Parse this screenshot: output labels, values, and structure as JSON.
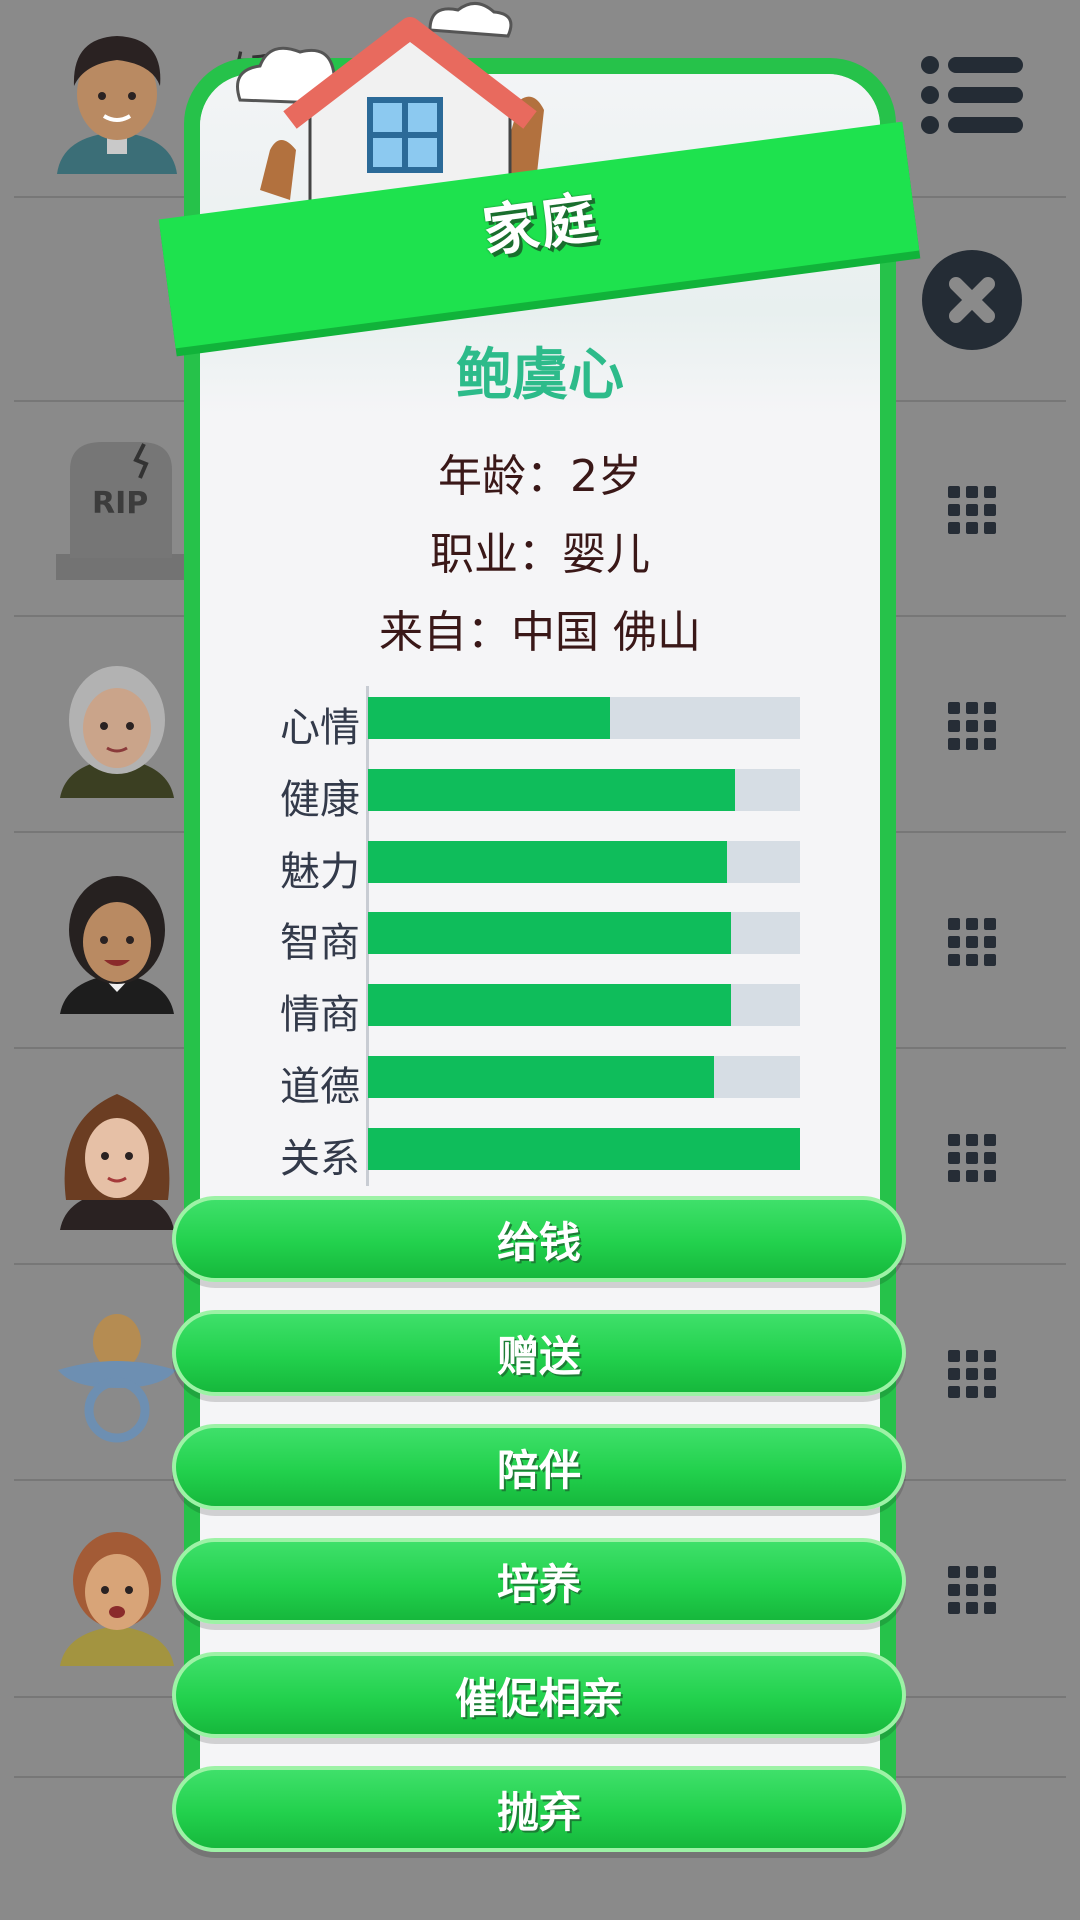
{
  "background": {
    "name_fragment": "饭送",
    "rows": [
      {
        "avatar": "father-avatar",
        "has_grid_icon": false
      },
      {
        "avatar": "blank",
        "has_grid_icon": false
      },
      {
        "avatar": "tombstone-rip",
        "has_grid_icon": true
      },
      {
        "avatar": "grandmother-avatar",
        "has_grid_icon": true
      },
      {
        "avatar": "mother-avatar",
        "has_grid_icon": true
      },
      {
        "avatar": "woman-avatar",
        "has_grid_icon": true
      },
      {
        "avatar": "pacifier-baby",
        "has_grid_icon": true
      },
      {
        "avatar": "girl-avatar",
        "has_grid_icon": true
      }
    ],
    "tombstone_text": "RIP"
  },
  "modal": {
    "banner_title": "家庭",
    "name": "鲍虞心",
    "age_line": "年龄：2岁",
    "job_line": "职业：婴儿",
    "from_line": "来自：中国 佛山",
    "stats": [
      {
        "label": "心情",
        "value": 0.56
      },
      {
        "label": "健康",
        "value": 0.85
      },
      {
        "label": "魅力",
        "value": 0.83
      },
      {
        "label": "智商",
        "value": 0.84
      },
      {
        "label": "情商",
        "value": 0.84
      },
      {
        "label": "道德",
        "value": 0.8
      },
      {
        "label": "关系",
        "value": 1.0
      }
    ],
    "actions": [
      "给钱",
      "赠送",
      "陪伴",
      "培养",
      "催促相亲",
      "抛弃"
    ]
  },
  "colors": {
    "accent_green": "#1ee24e",
    "stat_fill": "#0fbd5b",
    "stat_track": "#d6dde4",
    "name_color": "#2dbb8a"
  }
}
